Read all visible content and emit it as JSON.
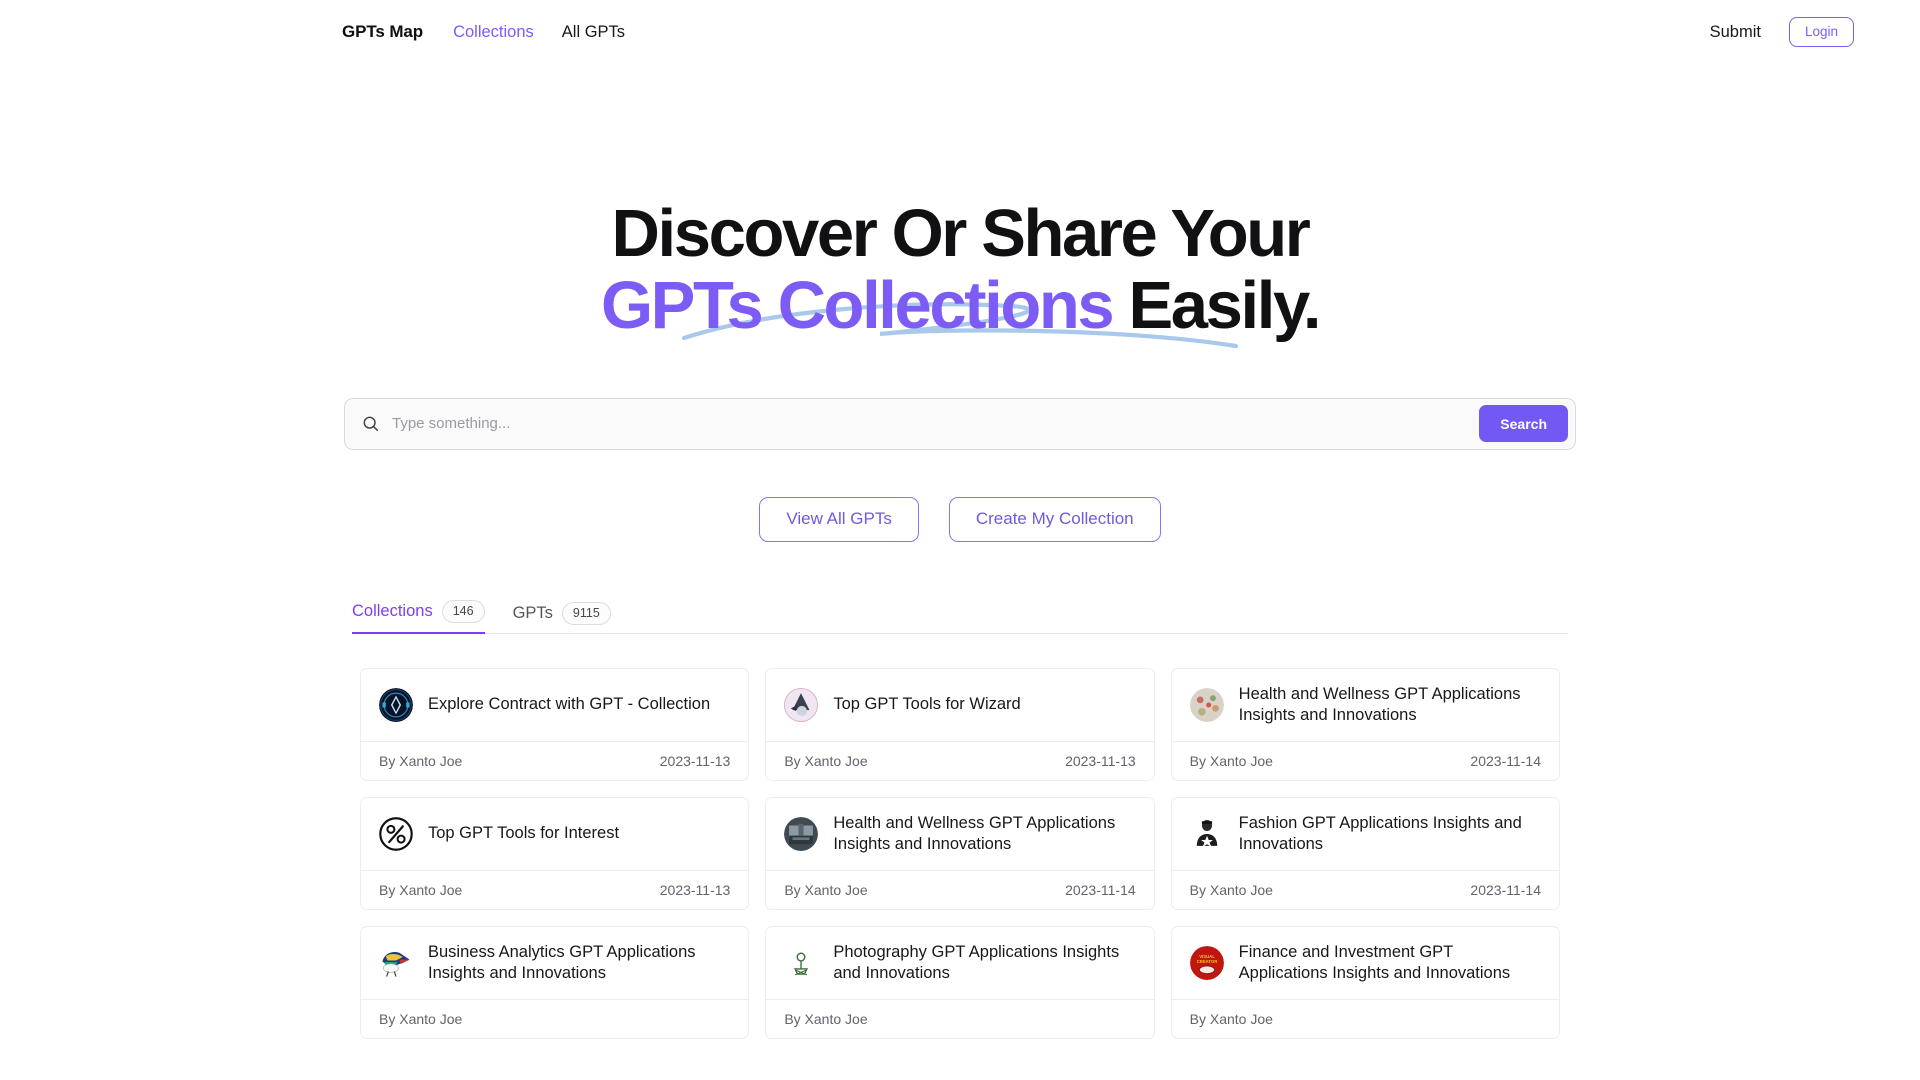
{
  "header": {
    "brand": "GPTs Map",
    "nav": [
      {
        "label": "Collections",
        "active": true
      },
      {
        "label": "All GPTs",
        "active": false
      }
    ],
    "submit_label": "Submit",
    "login_label": "Login"
  },
  "hero": {
    "line1": "Discover Or Share Your",
    "line2_accent": "GPTs Collections",
    "line2_rest": " Easily.",
    "underline_color": "#a9c9ec"
  },
  "search": {
    "placeholder": "Type something...",
    "value": "",
    "button_label": "Search",
    "icon": "search-icon",
    "button_color": "#7358f4"
  },
  "cta": {
    "view_all_label": "View All GPTs",
    "create_label": "Create My Collection",
    "border_color": "#8b74f0"
  },
  "tabs": [
    {
      "label": "Collections",
      "count": "146",
      "active": true
    },
    {
      "label": "GPTs",
      "count": "9115",
      "active": false
    }
  ],
  "accent_color": "#7c5cf5",
  "cards": [
    {
      "title": "Explore Contract with GPT - Collection",
      "author": "By Xanto Joe",
      "date": "2023-11-13",
      "avatar": "contract-orb-avatar"
    },
    {
      "title": "Top GPT Tools for Wizard",
      "author": "By Xanto Joe",
      "date": "2023-11-13",
      "avatar": "wizard-avatar"
    },
    {
      "title": "Health and Wellness GPT Applications Insights and Innovations",
      "author": "By Xanto Joe",
      "date": "2023-11-14",
      "avatar": "health-avatar"
    },
    {
      "title": "Top GPT Tools for Interest",
      "author": "By Xanto Joe",
      "date": "2023-11-13",
      "avatar": "percent-icon-avatar"
    },
    {
      "title": "Health and Wellness GPT Applications Insights and Innovations",
      "author": "By Xanto Joe",
      "date": "2023-11-14",
      "avatar": "gym-avatar"
    },
    {
      "title": "Fashion GPT Applications Insights and Innovations",
      "author": "By Xanto Joe",
      "date": "2023-11-14",
      "avatar": "fashion-avatar"
    },
    {
      "title": "Business Analytics GPT Applications Insights and Innovations",
      "author": "By Xanto Joe",
      "date": "",
      "avatar": "bird-analytics-avatar"
    },
    {
      "title": "Photography GPT Applications Insights and Innovations",
      "author": "By Xanto Joe",
      "date": "",
      "avatar": "photography-avatar"
    },
    {
      "title": "Finance and Investment GPT Applications Insights and Innovations",
      "author": "By Xanto Joe",
      "date": "",
      "avatar": "finance-avatar"
    }
  ]
}
